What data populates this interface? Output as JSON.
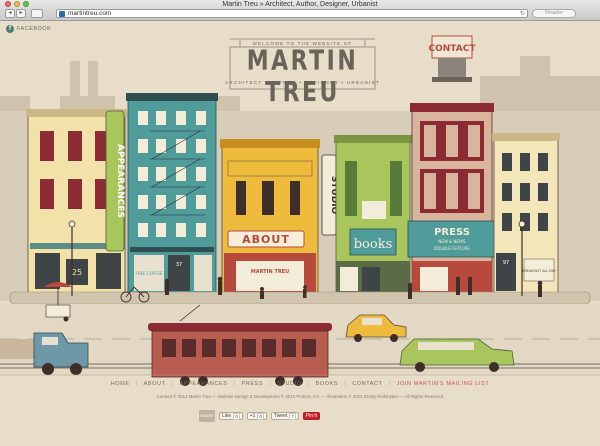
{
  "browser": {
    "window_title": "Martin Treu » Architect, Author, Designer, Urbanist",
    "url": "martintreu.com",
    "reader_label": "Reader",
    "back_glyph": "◂",
    "forward_glyph": "▸",
    "reload_glyph": "↻"
  },
  "site": {
    "facebook_label": "FACEBOOK",
    "welcome": "WELCOME TO THE WEBSITE OF",
    "title": "MARTIN TREU",
    "subtitle": "ARCHITECT • AUTHOR • DESIGNER • URBANIST",
    "contact_sign": "CONTACT",
    "signs": {
      "appearances": "APPEARANCES",
      "studio": "STUDIO",
      "about": "ABOUT",
      "martin_treu_sign": "MARTIN TREU",
      "books": "books",
      "press": "PRESS",
      "press_sub": "NEW & NEWS",
      "press_sub2": "DOUBLE FEATURE",
      "coffee": "FREE COFFEE",
      "num_25": "25",
      "num_37": "37",
      "num_97": "97",
      "shop_sign": "BREAKFAST ALL DAY"
    },
    "footer_nav": {
      "home": "HOME",
      "about": "ABOUT",
      "appearances": "APPEARANCES",
      "press": "PRESS",
      "studio": "STUDIO",
      "books": "BOOKS",
      "contact": "CONTACT",
      "mailing": "JOIN MARTIN'S MAILING LIST"
    },
    "credits": "Content © 2012 Martin Treu — Website Design & Development © 2012 ProkoS, Inc. — Illustration © 2012 Scotty Reifsnyder — All Rights Reserved",
    "share": {
      "label": "SHARE",
      "like": "Like",
      "like_count": "0",
      "plus": "+1",
      "plus_count": "0",
      "tweet": "Tweet",
      "tweet_count": "7",
      "pin": "Pin it"
    }
  },
  "colors": {
    "background": "#e7ddc9",
    "brown": "#6b6259",
    "teal": "#4f9c9a",
    "red": "#b74a3c",
    "yellow": "#eebb3d",
    "green": "#a9c65c",
    "accent_mail": "#c0594a"
  }
}
